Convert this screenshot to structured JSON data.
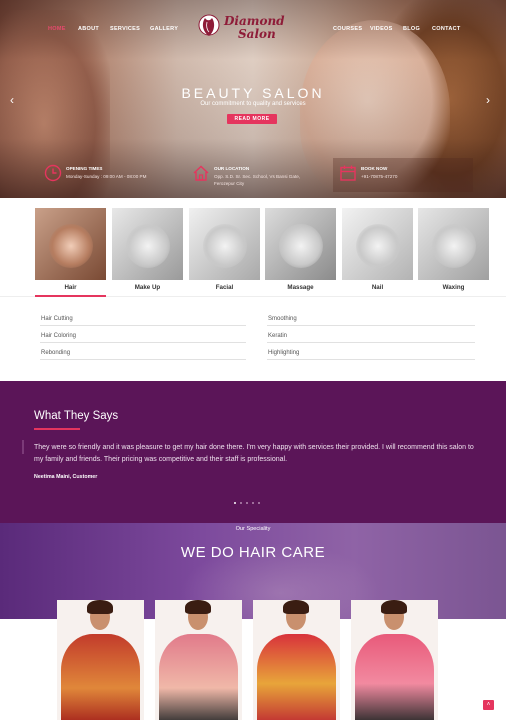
{
  "nav": {
    "left": [
      "Home",
      "About",
      "Services",
      "Gallery"
    ],
    "right": [
      "Courses",
      "Videos",
      "Blog",
      "Contact"
    ]
  },
  "logo": {
    "line1": "Diamond",
    "line2": "Salon"
  },
  "hero": {
    "title": "BEAUTY SALON",
    "subtitle": "Our commitment to quality and services",
    "button": "READ MORE"
  },
  "info": {
    "opening": {
      "label": "Opening Times",
      "value": "Monday-Sunday : 09:00 AM - 08:00 PM"
    },
    "location": {
      "label": "Our Location",
      "line1": "Opp. S.D. Sr. Sec. School, Vs Bansi Gate,",
      "line2": "Ferozepur City"
    },
    "book": {
      "label": "Book Now",
      "value": "+91-70875-47270"
    }
  },
  "services": [
    {
      "label": "Hair"
    },
    {
      "label": "Make Up"
    },
    {
      "label": "Facial"
    },
    {
      "label": "Massage"
    },
    {
      "label": "Nail"
    },
    {
      "label": "Waxing"
    }
  ],
  "hair_items": {
    "left": [
      "Hair Cutting",
      "Hair Coloring",
      "Rebonding"
    ],
    "right": [
      "Smoothing",
      "Keratin",
      "Highlighting"
    ]
  },
  "testimonial": {
    "title": "What They Says",
    "text": "They were so friendly and it was pleasure to get my hair done there. I'm very happy with services their provided. I will recommend this salon to my family and friends. Their pricing was competitive and their staff is professional.",
    "author": "Neetima Maini, Customer",
    "dots": 5,
    "active_dot": 0
  },
  "speciality": {
    "kicker": "Our Speciality",
    "title": "WE DO HAIR CARE"
  },
  "colors": {
    "accent": "#e5355e",
    "testimonial_bg": "#5b1558",
    "speciality_bg": "#7d4a9d",
    "logo": "#8e1c38"
  },
  "icons": {
    "scroll_top": "chevron-up-icon"
  }
}
